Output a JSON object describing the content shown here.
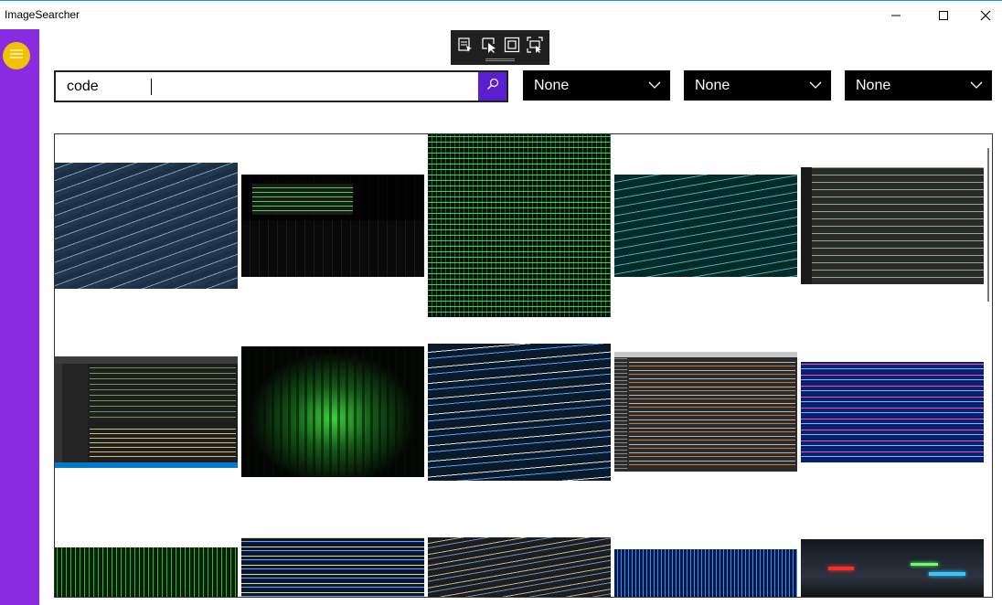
{
  "window": {
    "title": "ImageSearcher"
  },
  "search": {
    "query": "code",
    "placeholder": ""
  },
  "filters": [
    {
      "selected": "None"
    },
    {
      "selected": "None"
    },
    {
      "selected": "None"
    }
  ],
  "icons": {
    "menu": "hamburger-icon",
    "search": "search-icon",
    "window_minimize": "minimize-icon",
    "window_maximize": "maximize-icon",
    "window_close": "close-icon",
    "toolbar": [
      "app-select-icon",
      "select-element-icon",
      "display-layout-icon",
      "track-focus-icon"
    ]
  },
  "colors": {
    "sidebar": "#8a2be2",
    "menu_button": "#f2c200",
    "search_button": "#5a1fd0",
    "dropdown_bg": "#000000",
    "toolbar_bg": "#1f1f1f"
  },
  "results": [
    {
      "subject": "HTML source code on a dark blue screen"
    },
    {
      "subject": "laptop keyboard with green terminal text"
    },
    {
      "subject": "green binary digits on black"
    },
    {
      "subject": "teal binary digits"
    },
    {
      "subject": "HTML code in a dark editor"
    },
    {
      "subject": "code editor window with sidebar"
    },
    {
      "subject": "green matrix code rain"
    },
    {
      "subject": "stylesheet and javascript include tags"
    },
    {
      "subject": "source code in a dark IDE"
    },
    {
      "subject": "blue code on a monitor"
    },
    {
      "subject": "green matrix rain"
    },
    {
      "subject": "code with colored syntax"
    },
    {
      "subject": "code on a screen, dark"
    },
    {
      "subject": "blue digital rain"
    },
    {
      "subject": "figures with lightsabers"
    }
  ]
}
